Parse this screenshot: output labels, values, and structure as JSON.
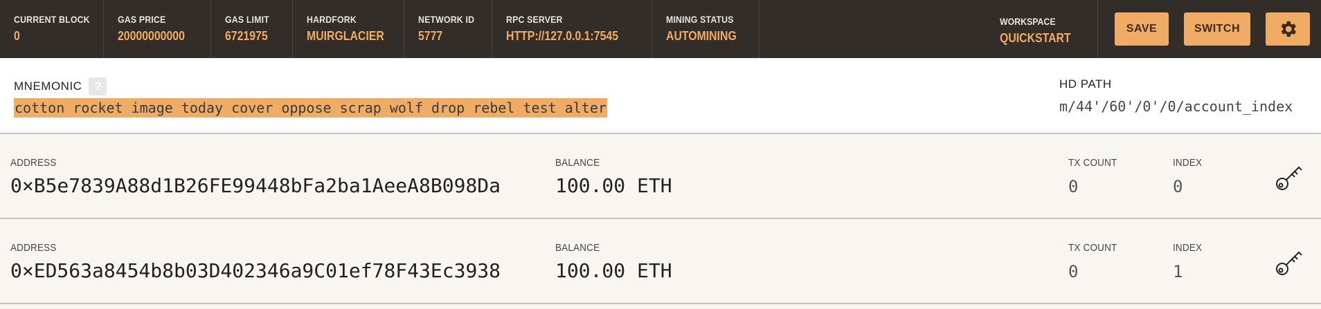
{
  "topbar": {
    "stats": [
      {
        "label": "CURRENT BLOCK",
        "value": "0"
      },
      {
        "label": "GAS PRICE",
        "value": "20000000000"
      },
      {
        "label": "GAS LIMIT",
        "value": "6721975"
      },
      {
        "label": "HARDFORK",
        "value": "MUIRGLACIER"
      },
      {
        "label": "NETWORK ID",
        "value": "5777"
      },
      {
        "label": "RPC SERVER",
        "value": "HTTP://127.0.0.1:7545"
      },
      {
        "label": "MINING STATUS",
        "value": "AUTOMINING"
      }
    ],
    "workspace_label": "WORKSPACE",
    "workspace_value": "QUICKSTART",
    "save_label": "SAVE",
    "switch_label": "SWITCH",
    "settings_icon": "gear-icon"
  },
  "mnemonic": {
    "label": "MNEMONIC",
    "help": "?",
    "words": "cotton rocket image today cover oppose scrap wolf drop rebel test alter",
    "hd_label": "HD PATH",
    "hd_value": "m/44'/60'/0'/0/account_index"
  },
  "accounts": [
    {
      "address_label": "ADDRESS",
      "address": "0×B5e7839A88d1B26FE99448bFa2ba1AeeA8B098Da",
      "balance_label": "BALANCE",
      "balance": "100.00 ETH",
      "tx_label": "TX COUNT",
      "tx": "0",
      "index_label": "INDEX",
      "index": "0",
      "icon": "key-icon"
    },
    {
      "address_label": "ADDRESS",
      "address": "0×ED563a8454b8b03D402346a9C01ef78F43Ec3938",
      "balance_label": "BALANCE",
      "balance": "100.00 ETH",
      "tx_label": "TX COUNT",
      "tx": "0",
      "index_label": "INDEX",
      "index": "1",
      "icon": "key-icon"
    }
  ],
  "colors": {
    "accent": "#f0ac64",
    "topbar": "#322d29",
    "background": "#f8f6f1"
  }
}
